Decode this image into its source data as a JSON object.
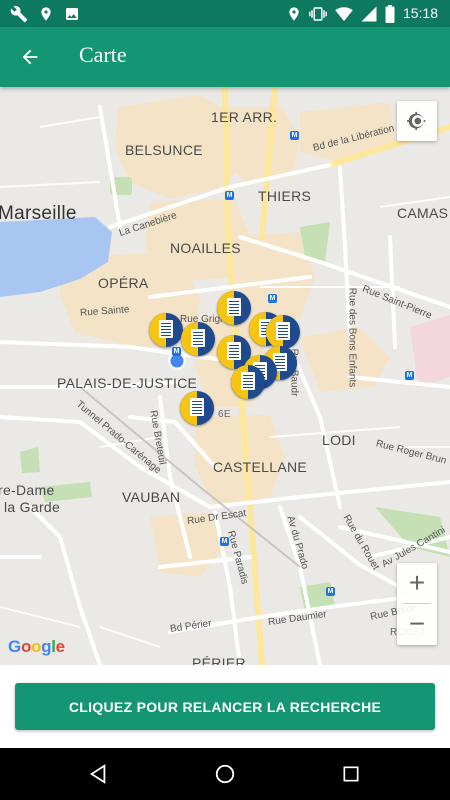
{
  "status_bar": {
    "time": "15:18",
    "left_icons": [
      "wrench-icon",
      "location-pin-icon",
      "image-icon"
    ],
    "right_icons": [
      "location-pin-icon",
      "vibrate-icon",
      "wifi-icon",
      "signal-icon",
      "battery-icon"
    ]
  },
  "app_bar": {
    "title": "Carte",
    "back_icon": "arrow-back-icon",
    "color": "#159673"
  },
  "map": {
    "city": "Marseille",
    "districts": [
      "1ER ARR.",
      "BELSUNCE",
      "THIERS",
      "CAMAS",
      "NOAILLES",
      "OPÉRA",
      "PALAIS-DE-JUSTICE",
      "LODI",
      "CASTELLANE",
      "VAUBAN",
      "6E",
      "PÉRIER"
    ],
    "streets": [
      "Bd de la Libération",
      "La Canebière",
      "Rue Saint-Pierre",
      "Rue des Bons Enfants",
      "Rue Sainte",
      "Rue Grignan",
      "Tunnel Prado-Carénage",
      "Rue Breteuil",
      "Rue Roger Brun",
      "Rue Dr Escat",
      "Av du Prado",
      "Rue du Rouet",
      "Av Jules Cantini",
      "Rue Paradis",
      "Rue Daumier",
      "Bd Périer",
      "Rue Borde",
      "ROUET",
      "Rue Baudr"
    ],
    "landmark": [
      "re-Dame",
      "la Garde"
    ],
    "attribution": "Google",
    "markers_count": 9,
    "marker_colors": {
      "left": "#f6c513",
      "right": "#1f4b8e"
    },
    "zoom_in": "+",
    "zoom_out": "−"
  },
  "search": {
    "button_label": "CLIQUEZ POUR RELANCER LA RECHERCHE"
  },
  "nav_bar": {
    "icons": [
      "back-triangle-icon",
      "home-circle-icon",
      "recents-square-icon"
    ]
  }
}
